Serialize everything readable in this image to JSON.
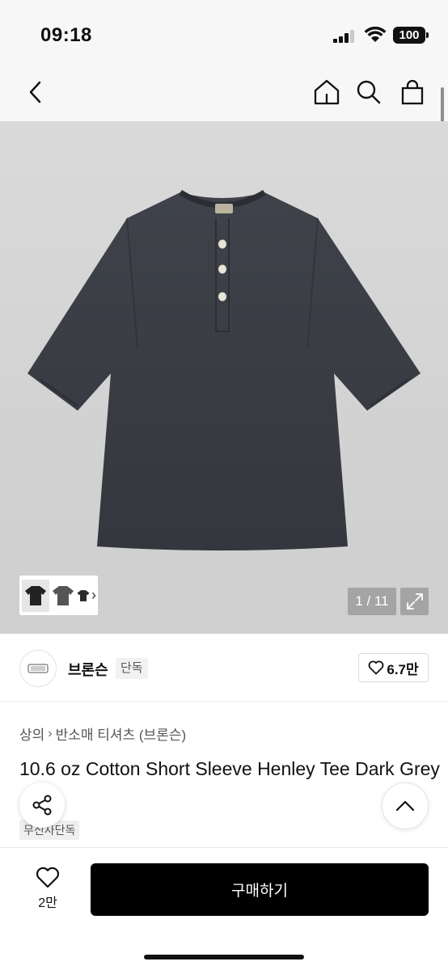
{
  "status_bar": {
    "time": "09:18",
    "battery": "100"
  },
  "nav": {
    "icons": [
      "chevron-left-icon",
      "home-icon",
      "search-icon",
      "shopping-bag-icon"
    ]
  },
  "gallery": {
    "counter": "1 / 11"
  },
  "brand": {
    "name": "브론슨",
    "badge": "단독",
    "likes": "6.7만"
  },
  "breadcrumb": {
    "items": [
      "상의",
      "반소매 티셔츠 (브론슨)"
    ]
  },
  "product": {
    "title": "10.6 oz Cotton Short Sleeve Henley Tee Dark Grey",
    "badge": "무신사단독"
  },
  "bottom_bar": {
    "wish_count": "2만",
    "buy_label": "구매하기"
  },
  "colors": {
    "shirt": "#3b3e45",
    "background": "#d6d6d6",
    "buy_button": "#000000"
  }
}
